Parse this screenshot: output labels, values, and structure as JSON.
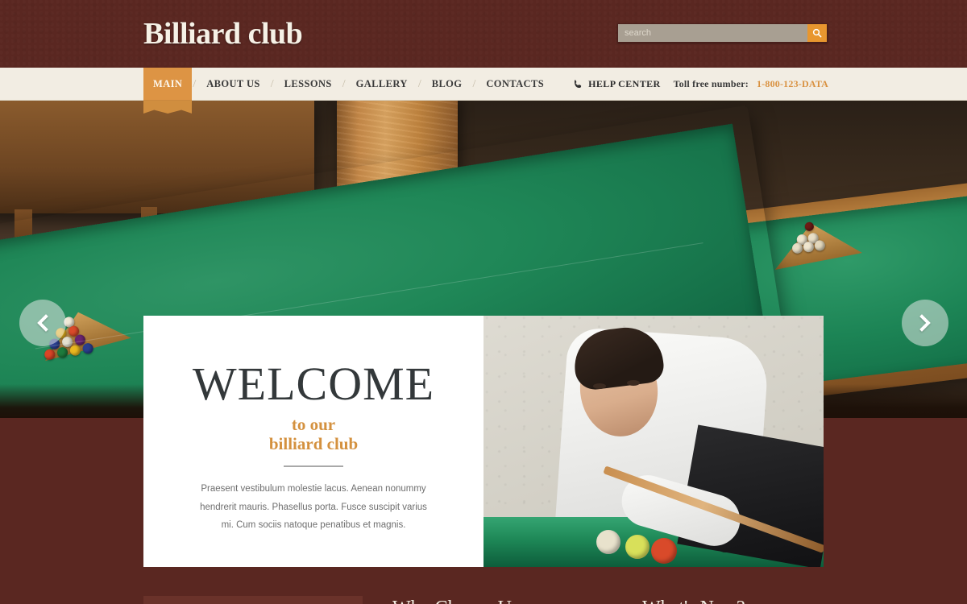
{
  "site": {
    "logo": "Billiard club",
    "background_color": "#5a2721",
    "accent_color": "#dd9444",
    "nav_background": "#f2ede3"
  },
  "search": {
    "placeholder": "search",
    "value": "",
    "button_icon": "search-icon"
  },
  "nav": {
    "items": [
      {
        "label": "MAIN",
        "active": true
      },
      {
        "label": "ABOUT US",
        "active": false
      },
      {
        "label": "LESSONS",
        "active": false
      },
      {
        "label": "GALLERY",
        "active": false
      },
      {
        "label": "BLOG",
        "active": false
      },
      {
        "label": "CONTACTS",
        "active": false
      }
    ],
    "separator": "/"
  },
  "contact": {
    "phone_icon": "phone-icon",
    "help_center": "HELP CENTER",
    "toll_label": "Toll free number:",
    "toll_number": "1-800-123-DATA",
    "toll_number_color": "#d99140"
  },
  "hero": {
    "prev_icon": "chevron-left-icon",
    "next_icon": "chevron-right-icon",
    "image_alt": "billiard-room-tables"
  },
  "welcome": {
    "title": "WELCOME",
    "subtitle_line1": "to our",
    "subtitle_line2": "billiard club",
    "body": "Praesent vestibulum molestie lacus. Aenean nonummy hendrerit mauris. Phasellus porta. Fusce suscipit varius mi. Cum sociis natoque penatibus et magnis.",
    "title_color": "#33383a",
    "subtitle_color": "#d4913f"
  },
  "photo": {
    "alt": "billiard-player-aiming-cue"
  },
  "lower": {
    "heading_left": "Why Choose Us",
    "heading_right": "What's New?"
  }
}
